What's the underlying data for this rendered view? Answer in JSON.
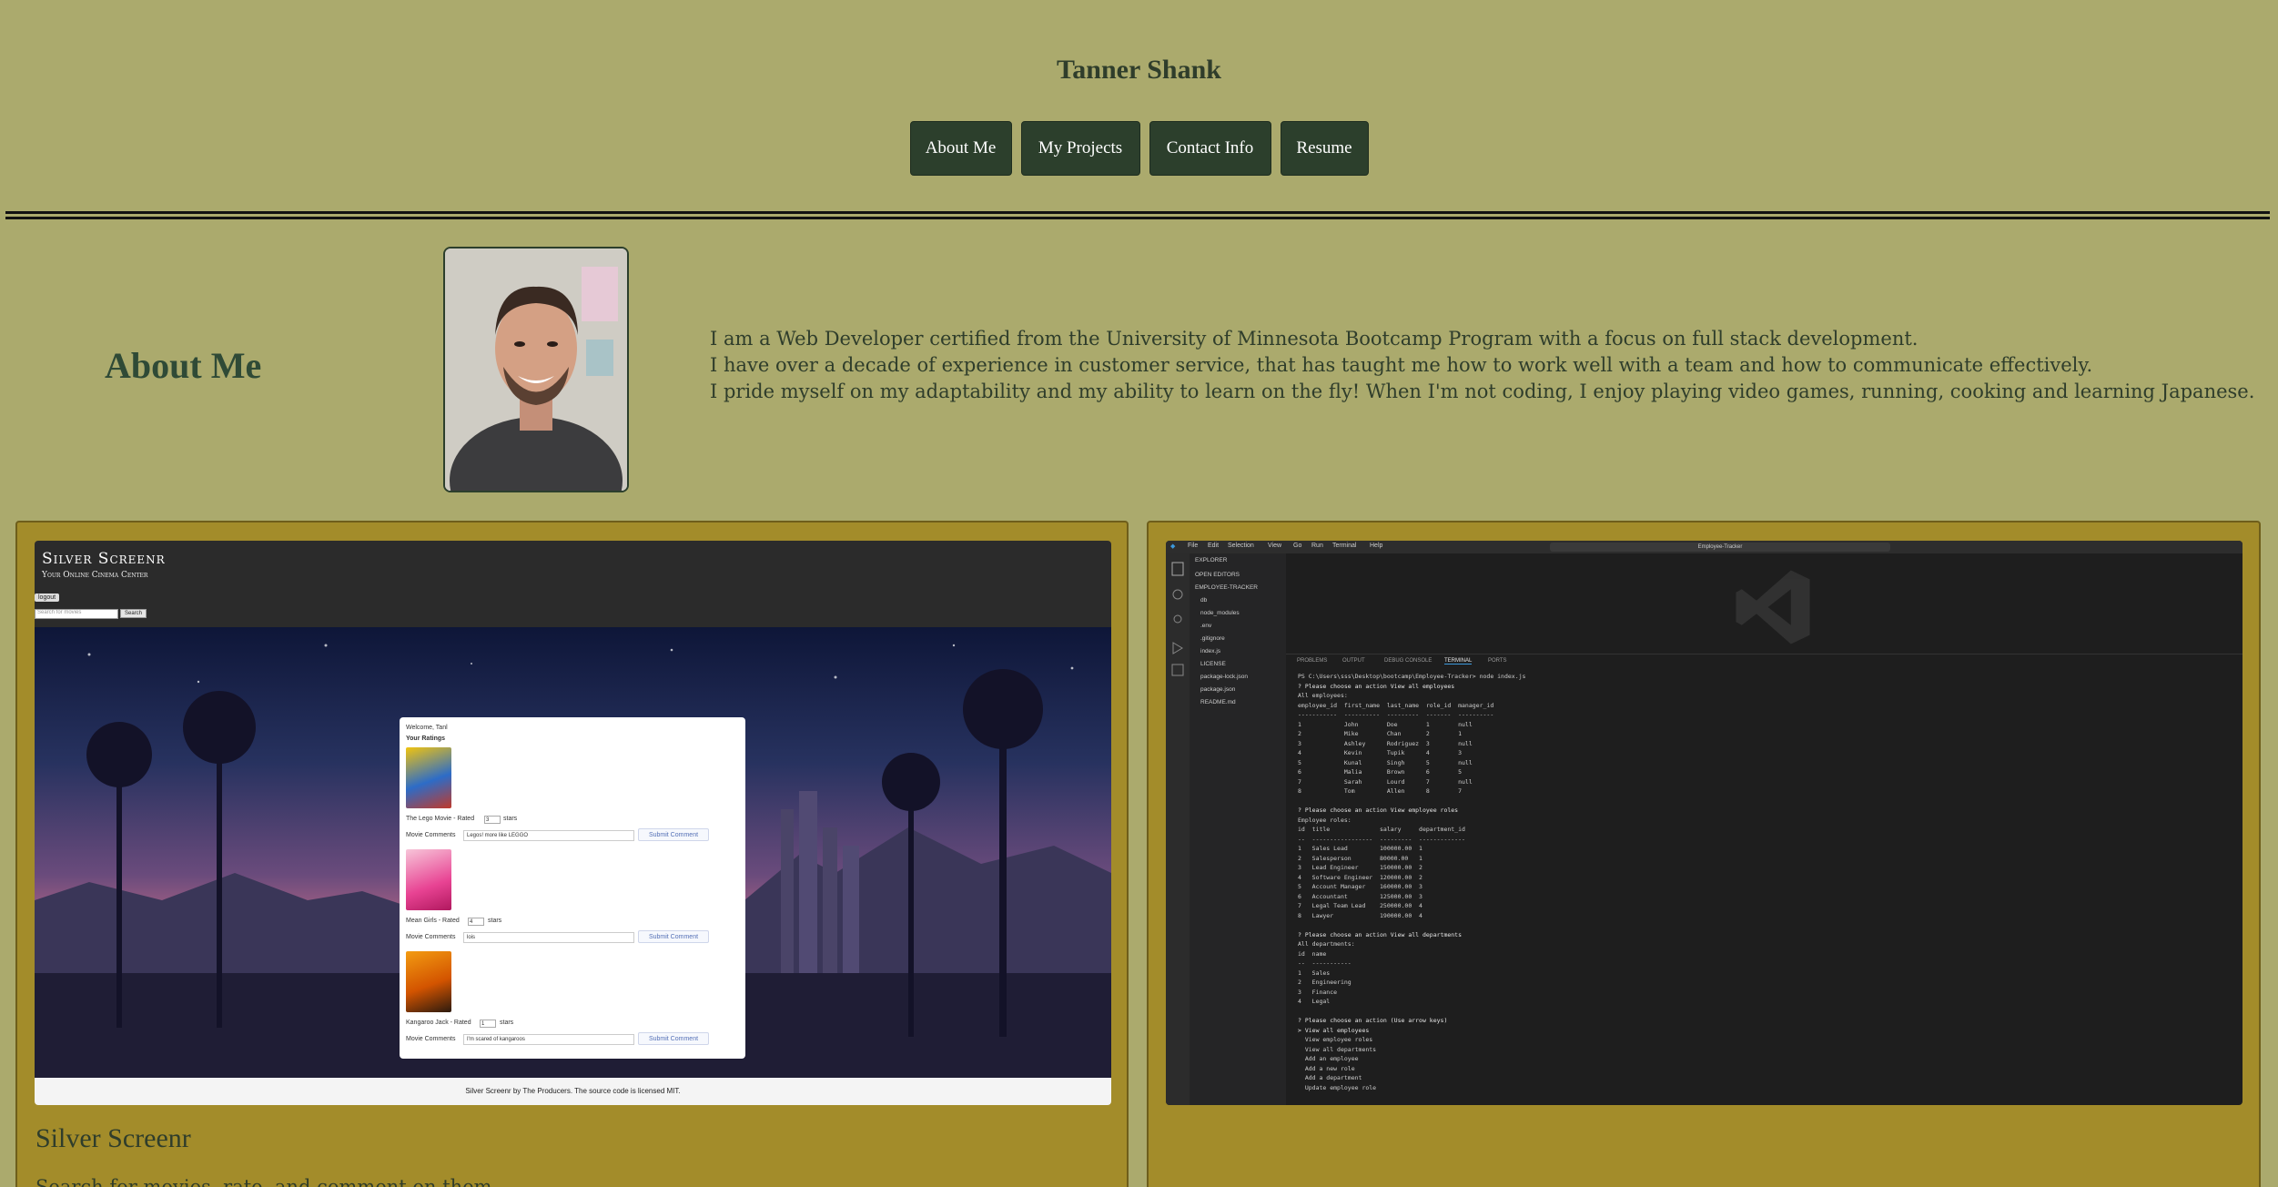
{
  "header": {
    "name": "Tanner Shank",
    "nav": [
      "About Me",
      "My Projects",
      "Contact Info",
      "Resume"
    ]
  },
  "about": {
    "heading": "About Me",
    "lines": [
      "I am a Web Developer certified from the University of Minnesota Bootcamp Program with a focus on full stack development.",
      "I have over a decade of experience in customer service, that has taught me how to work well with a team and how to communicate effectively.",
      "I pride myself on my adaptability and my ability to learn on the fly! When I'm not coding, I enjoy playing video games, running, cooking and learning Japanese."
    ]
  },
  "projects": [
    {
      "title": "Silver Screenr",
      "description": "Search for movies, rate, and comment on them.",
      "screenshot": {
        "logo": "Silver Screenr",
        "tagline": "Your Online Cinema Center",
        "logout": "logout",
        "search_placeholder": "Search for movies",
        "search_button": "Search",
        "welcome": "Welcome, Tanl",
        "your_ratings": "Your Ratings",
        "submit_label": "Submit Comment",
        "comments_label": "Movie Comments",
        "stars_label": "stars",
        "movies": [
          {
            "rating_text": "The Lego Movie - Rated",
            "rating": "3",
            "comment": "Legos! more like LEGGO"
          },
          {
            "rating_text": "Mean Girls - Rated",
            "rating": "4",
            "comment": "lois"
          },
          {
            "rating_text": "Kangaroo Jack - Rated",
            "rating": "1",
            "comment": "I'm scared of kangaroos"
          }
        ],
        "footer": "Silver Screenr by The Producers. The source code is licensed MIT."
      }
    },
    {
      "title": "",
      "screenshot": {
        "menu": [
          "File",
          "Edit",
          "Selection",
          "View",
          "Go",
          "Run",
          "Terminal",
          "Help"
        ],
        "search": "Employee-Tracker",
        "explorer": "EXPLORER",
        "open_editors": "OPEN EDITORS",
        "project_folder": "EMPLOYEE-TRACKER",
        "files": [
          "db",
          "node_modules",
          ".env",
          ".gitignore",
          "index.js",
          "LICENSE",
          "package-lock.json",
          "package.json",
          "README.md"
        ],
        "panel_tabs": [
          "PROBLEMS",
          "OUTPUT",
          "DEBUG CONSOLE",
          "TERMINAL",
          "PORTS"
        ],
        "terminal_lines": [
          "PS C:\\Users\\sss\\Desktop\\bootcamp\\Employee-Tracker> node index.js",
          "? Please choose an action View all employees",
          "All employees:",
          "employee_id  first_name  last_name  role_id  manager_id",
          "-----------  ----------  ---------  -------  ----------",
          "1            John        Doe        1        null",
          "2            Mike        Chan       2        1",
          "3            Ashley      Rodriguez  3        null",
          "4            Kevin       Tupik      4        3",
          "5            Kunal       Singh      5        null",
          "6            Malia       Brown      6        5",
          "7            Sarah       Lourd      7        null",
          "8            Tom         Allen      8        7",
          "",
          "? Please choose an action View employee roles",
          "Employee roles:",
          "id  title              salary     department_id",
          "--  -----------------  ---------  -------------",
          "1   Sales Lead         100000.00  1",
          "2   Salesperson        80000.00   1",
          "3   Lead Engineer      150000.00  2",
          "4   Software Engineer  120000.00  2",
          "5   Account Manager    160000.00  3",
          "6   Accountant         125000.00  3",
          "7   Legal Team Lead    250000.00  4",
          "8   Lawyer             190000.00  4",
          "",
          "? Please choose an action View all departments",
          "All departments:",
          "id  name",
          "--  -----------",
          "1   Sales",
          "2   Engineering",
          "3   Finance",
          "4   Legal",
          "",
          "? Please choose an action (Use arrow keys)",
          "> View all employees",
          "  View employee roles",
          "  View all departments",
          "  Add an employee",
          "  Add a new role",
          "  Add a department",
          "  Update employee role"
        ]
      }
    }
  ],
  "colors": {
    "background": "#abaa6d",
    "button": "#2c3f2c",
    "card": "#a38c2a",
    "text": "#2f3d2b"
  }
}
